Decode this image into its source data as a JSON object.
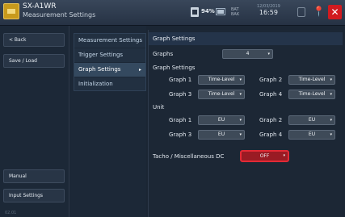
{
  "header": {
    "app_name": "SX-A1WR",
    "app_subtitle": "Measurement Settings",
    "storage_percent": "94%",
    "battery_label": "BAT\nBAK",
    "date": "12/03/2019",
    "time": "16:59"
  },
  "sidebar": {
    "back": "< Back",
    "save_load": "Save / Load",
    "manual": "Manual",
    "input_settings": "Input Settings",
    "version": "02.01"
  },
  "menu": {
    "items": [
      {
        "label": "Measurement Settings"
      },
      {
        "label": "Trigger Settings"
      },
      {
        "label": "Graph Settings"
      },
      {
        "label": "Initialization"
      }
    ],
    "active_arrow": "▸"
  },
  "content": {
    "title": "Graph Settings",
    "graphs_label": "Graphs",
    "graphs_value": "4",
    "graph_settings_label": "Graph Settings",
    "graph_settings": [
      {
        "label": "Graph 1",
        "value": "Time-Level"
      },
      {
        "label": "Graph 2",
        "value": "Time-Level"
      },
      {
        "label": "Graph 3",
        "value": "Time-Level"
      },
      {
        "label": "Graph 4",
        "value": "Time-Level"
      }
    ],
    "unit_label": "Unit",
    "units": [
      {
        "label": "Graph 1",
        "value": "EU"
      },
      {
        "label": "Graph 2",
        "value": "EU"
      },
      {
        "label": "Graph 3",
        "value": "EU"
      },
      {
        "label": "Graph 4",
        "value": "EU"
      }
    ],
    "tacho_label": "Tacho / Miscellaneous DC",
    "tacho_value": "OFF"
  },
  "colors": {
    "close": "#d11a1f",
    "highlight": "#e22a36",
    "active_menu": "#34495f"
  }
}
